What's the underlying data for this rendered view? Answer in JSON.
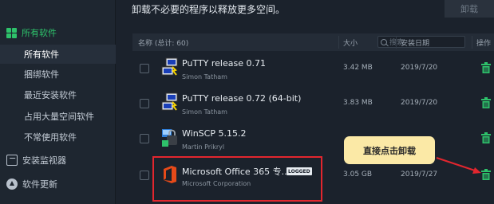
{
  "sidebar": {
    "main_label": "所有软件",
    "items": [
      {
        "label": "所有软件"
      },
      {
        "label": "捆绑软件"
      },
      {
        "label": "最近安装软件"
      },
      {
        "label": "占用大量空间软件"
      },
      {
        "label": "不常使用软件"
      }
    ],
    "monitor_label": "安装监视器",
    "update_label": "软件更新"
  },
  "header": {
    "text": "卸载不必要的程序以释放更多空间。",
    "uninstall_button": "卸载"
  },
  "columns": {
    "name": "名称 (总计: 60)",
    "search_placeholder": "搜索",
    "size": "大小",
    "install_date": "安装日期",
    "action": "操作"
  },
  "rows": [
    {
      "name": "PuTTY release 0.71",
      "publisher": "Simon Tatham",
      "size": "3.42 MB",
      "date": "2019/7/20",
      "icon": "putty-icon"
    },
    {
      "name": "PuTTY release 0.72 (64-bit)",
      "publisher": "Simon Tatham",
      "size": "3.83 MB",
      "date": "2019/7/20",
      "icon": "putty-icon"
    },
    {
      "name": "WinSCP 5.15.2",
      "publisher": "Martin Prikryl",
      "size": "",
      "date": "",
      "icon": "winscp-icon"
    },
    {
      "name": "Microsoft Office 365 专...",
      "publisher": "Microsoft Corporation",
      "size": "3.05 GB",
      "date": "2019/7/27",
      "icon": "office-icon",
      "badge": "LOGGED"
    }
  ],
  "callout": {
    "text": "直接点击卸载"
  },
  "colors": {
    "accent": "#2ec26b",
    "highlight": "#e2262e",
    "callout_bg": "#fbe9a6"
  }
}
